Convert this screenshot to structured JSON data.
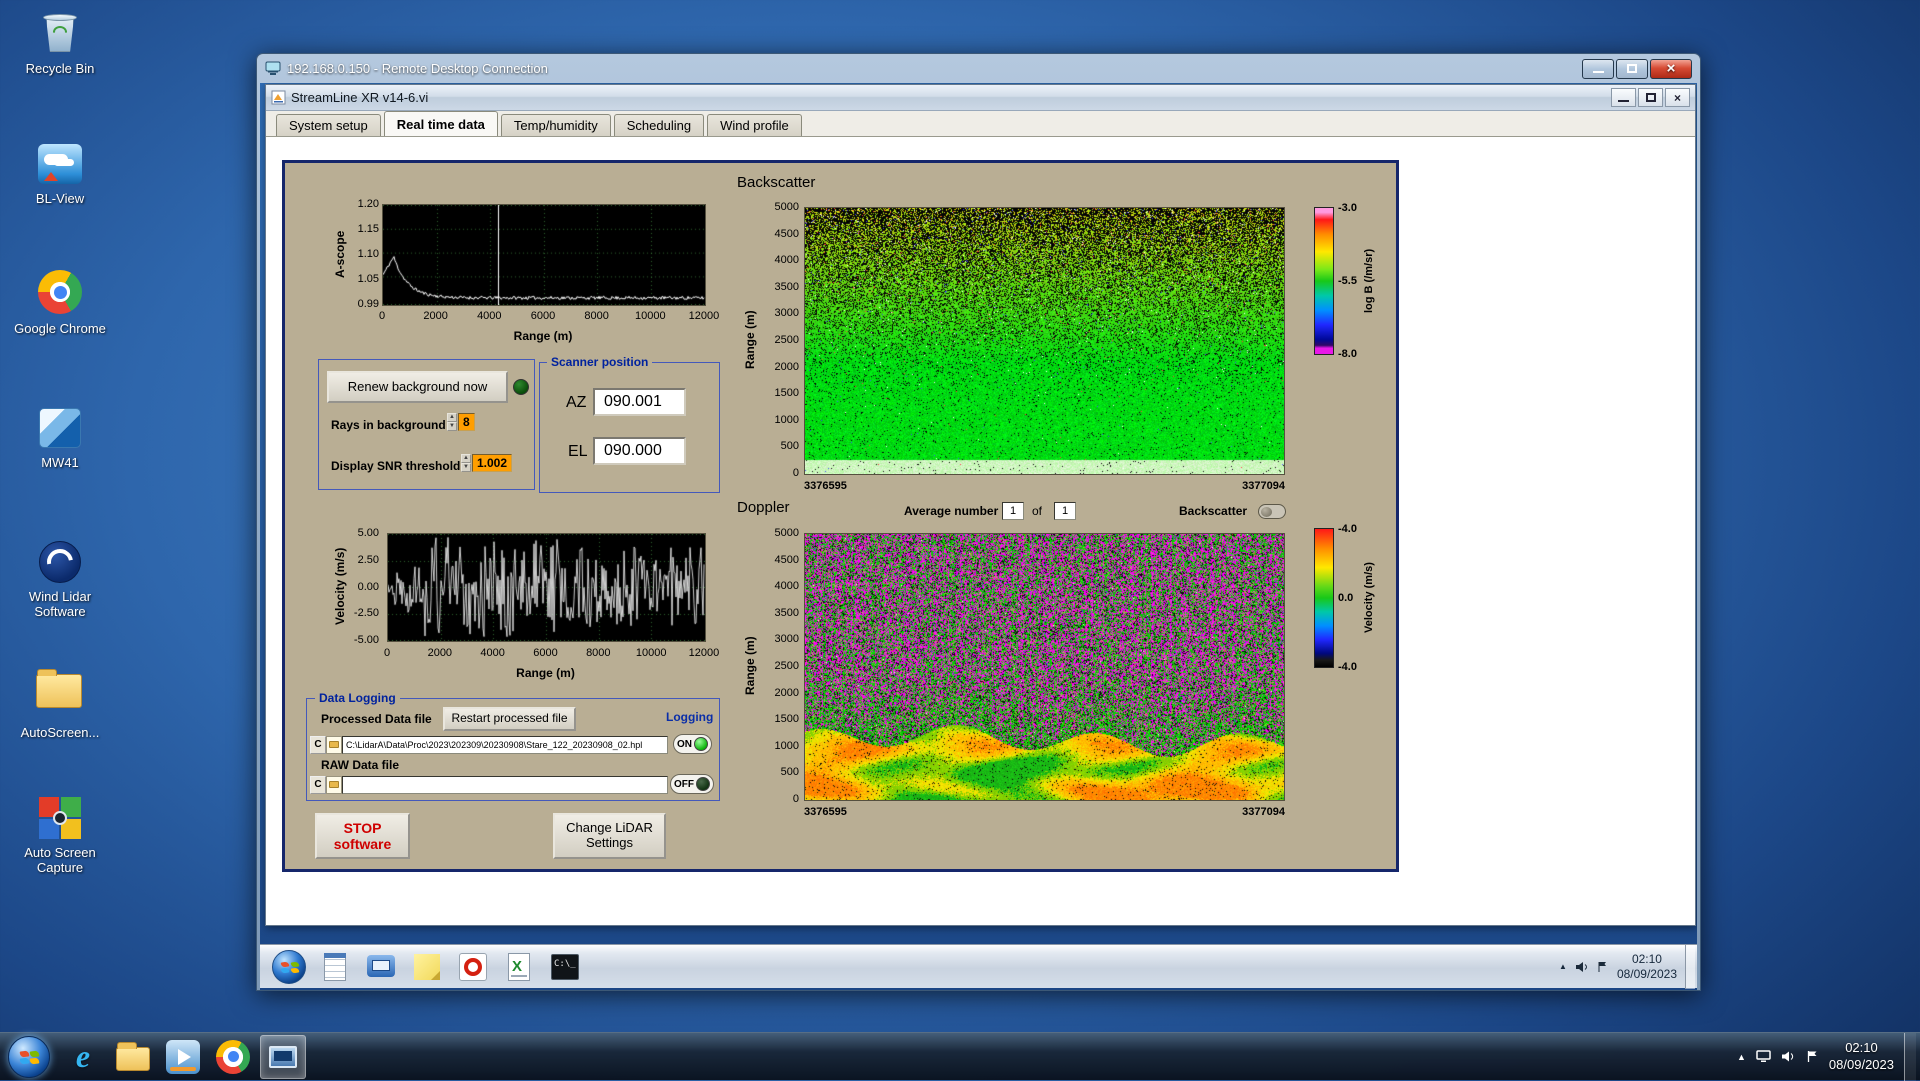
{
  "host": {
    "desktop_icons": [
      {
        "label": "Recycle Bin"
      },
      {
        "label": "BL-View"
      },
      {
        "label": "Google Chrome"
      },
      {
        "label": "MW41"
      },
      {
        "label": "Wind Lidar Software"
      },
      {
        "label": "AutoScreen..."
      },
      {
        "label": "Auto Screen Capture"
      }
    ],
    "taskbar": {
      "time": "02:10",
      "date": "08/09/2023"
    }
  },
  "rdp": {
    "title": "192.168.0.150 - Remote Desktop Connection",
    "remote_taskbar": {
      "time": "02:10",
      "date": "08/09/2023"
    }
  },
  "app": {
    "title": "StreamLine XR v14-6.vi",
    "tabs": [
      {
        "label": "System setup"
      },
      {
        "label": "Real time data"
      },
      {
        "label": "Temp/humidity"
      },
      {
        "label": "Scheduling"
      },
      {
        "label": "Wind profile"
      }
    ],
    "ascope": {
      "ylabel": "A-scope",
      "xlabel": "Range (m)",
      "yticks": [
        "1.20",
        "1.15",
        "1.10",
        "1.05",
        "0.99"
      ],
      "xticks": [
        "0",
        "2000",
        "4000",
        "6000",
        "8000",
        "10000",
        "12000"
      ]
    },
    "background_group": {
      "renew_button": "Renew background now",
      "rays_label": "Rays in background",
      "rays_value": "8",
      "snr_label": "Display SNR threshold",
      "snr_value": "1.002"
    },
    "scanner": {
      "title": "Scanner position",
      "az_label": "AZ",
      "az_value": "090.001",
      "el_label": "EL",
      "el_value": "090.000"
    },
    "backscatter": {
      "title": "Backscatter",
      "ylabel": "Range (m)",
      "yticks": [
        "5000",
        "4500",
        "4000",
        "3500",
        "3000",
        "2500",
        "2000",
        "1500",
        "1000",
        "500",
        "0"
      ],
      "x_left": "3376595",
      "x_right": "3377094",
      "colorbar_label": "log B (/m/sr)",
      "colorbar_ticks": [
        "-3.0",
        "-5.5",
        "-8.0"
      ]
    },
    "doppler_bar": {
      "title": "Doppler",
      "avg_label": "Average number",
      "avg_value": "1",
      "of_label": "of",
      "count_value": "1",
      "toggle_label": "Backscatter"
    },
    "velocity": {
      "ylabel": "Velocity (m/s)",
      "xlabel": "Range (m)",
      "yticks": [
        "5.00",
        "2.50",
        "0.00",
        "-2.50",
        "-5.00"
      ],
      "xticks": [
        "0",
        "2000",
        "4000",
        "6000",
        "8000",
        "10000",
        "12000"
      ]
    },
    "doppler": {
      "ylabel": "Range (m)",
      "yticks": [
        "5000",
        "4500",
        "4000",
        "3500",
        "3000",
        "2500",
        "2000",
        "1500",
        "1000",
        "500",
        "0"
      ],
      "x_left": "3376595",
      "x_right": "3377094",
      "colorbar_label": "Velocity (m/s)",
      "colorbar_ticks": [
        "-4.0",
        "0.0",
        "-4.0"
      ]
    },
    "logging": {
      "title": "Data Logging",
      "processed_label": "Processed Data file",
      "restart_button": "Restart processed file",
      "logging_label": "Logging",
      "drive_letter": "C",
      "processed_path": "C:\\LidarA\\Data\\Proc\\2023\\202309\\20230908\\Stare_122_20230908_02.hpl",
      "raw_path": "",
      "on_label": "ON",
      "raw_label": "RAW Data file",
      "off_label": "OFF"
    },
    "actions": {
      "stop_button": "STOP software",
      "settings_button": "Change LiDAR Settings"
    }
  }
}
